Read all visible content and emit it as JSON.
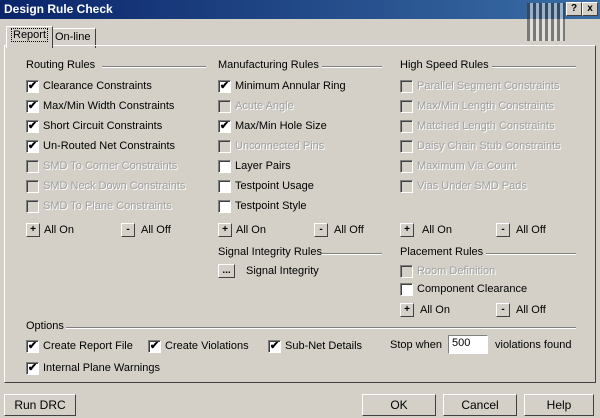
{
  "window": {
    "title": "Design Rule Check",
    "help_label": "?",
    "close_label": "x"
  },
  "tabs": [
    {
      "label": "Report"
    },
    {
      "label": "On-line"
    }
  ],
  "routing": {
    "title": "Routing Rules",
    "items": [
      {
        "label": "Clearance Constraints",
        "checked": true,
        "enabled": true
      },
      {
        "label": "Max/Min Width Constraints",
        "checked": true,
        "enabled": true
      },
      {
        "label": "Short Circuit Constraints",
        "checked": true,
        "enabled": true
      },
      {
        "label": "Un-Routed Net Constraints",
        "checked": true,
        "enabled": true
      },
      {
        "label": "SMD To Corner Constraints",
        "checked": false,
        "enabled": false
      },
      {
        "label": "SMD Neck Down Constraints",
        "checked": false,
        "enabled": false
      },
      {
        "label": "SMD To Plane Constraints",
        "checked": false,
        "enabled": false
      }
    ],
    "all_on": "All On",
    "all_off": "All Off"
  },
  "manufacturing": {
    "title": "Manufacturing Rules",
    "items": [
      {
        "label": "Minimum Annular Ring",
        "checked": true,
        "enabled": true
      },
      {
        "label": "Acute Angle",
        "checked": false,
        "enabled": false
      },
      {
        "label": "Max/Min Hole Size",
        "checked": true,
        "enabled": true
      },
      {
        "label": "Unconnected Pins",
        "checked": false,
        "enabled": false
      },
      {
        "label": "Layer Pairs",
        "checked": false,
        "enabled": true
      },
      {
        "label": "Testpoint Usage",
        "checked": false,
        "enabled": true
      },
      {
        "label": "Testpoint Style",
        "checked": false,
        "enabled": true
      }
    ],
    "all_on": "All On",
    "all_off": "All Off"
  },
  "high_speed": {
    "title": "High Speed Rules",
    "items": [
      {
        "label": "Parallel Segment Constraints",
        "checked": false,
        "enabled": false
      },
      {
        "label": "Max/Min Length Constraints",
        "checked": false,
        "enabled": false
      },
      {
        "label": "Matched Length Constraints",
        "checked": false,
        "enabled": false
      },
      {
        "label": "Daisy Chain Stub Constraints",
        "checked": false,
        "enabled": false
      },
      {
        "label": "Maximum Via Count",
        "checked": false,
        "enabled": false
      },
      {
        "label": "Vias Under SMD Pads",
        "checked": false,
        "enabled": false
      }
    ],
    "all_on": "All On",
    "all_off": "All Off"
  },
  "signal_integrity": {
    "title": "Signal Integrity Rules",
    "button": "...",
    "label": "Signal Integrity"
  },
  "placement": {
    "title": "Placement Rules",
    "items": [
      {
        "label": "Room Definition",
        "checked": false,
        "enabled": false
      },
      {
        "label": "Component Clearance",
        "checked": false,
        "enabled": true
      }
    ],
    "all_on": "All On",
    "all_off": "All Off"
  },
  "options": {
    "title": "Options",
    "create_report": {
      "label": "Create Report File",
      "checked": true
    },
    "create_violations": {
      "label": "Create Violations",
      "checked": true
    },
    "subnet_details": {
      "label": "Sub-Net Details",
      "checked": true
    },
    "internal_plane": {
      "label": "Internal Plane Warnings",
      "checked": true
    },
    "stop_when": "Stop when",
    "stop_value": "500",
    "violations_found": "violations found"
  },
  "buttons": {
    "run": "Run DRC",
    "ok": "OK",
    "cancel": "Cancel",
    "help": "Help"
  },
  "symbols": {
    "plus": "+",
    "minus": "-",
    "check": "✔"
  }
}
